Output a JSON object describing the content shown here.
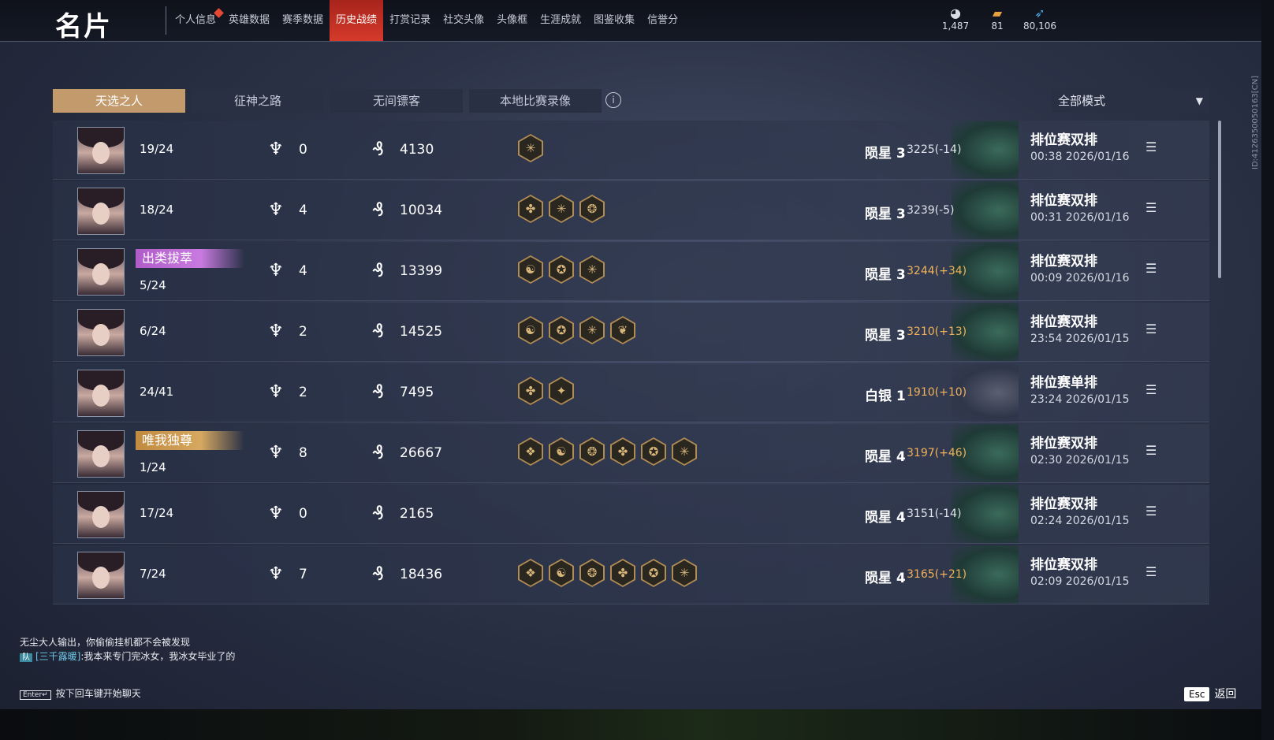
{
  "header": {
    "title": "名片",
    "nav": [
      {
        "label": "个人信息",
        "active": false,
        "dot": true
      },
      {
        "label": "英雄数据",
        "active": false
      },
      {
        "label": "赛季数据",
        "active": false
      },
      {
        "label": "历史战绩",
        "active": true
      },
      {
        "label": "打赏记录",
        "active": false
      },
      {
        "label": "社交头像",
        "active": false
      },
      {
        "label": "头像框",
        "active": false
      },
      {
        "label": "生涯成就",
        "active": false
      },
      {
        "label": "图鉴收集",
        "active": false
      },
      {
        "label": "信誉分",
        "active": false
      }
    ],
    "currencies": [
      {
        "icon": "mask-coin-icon",
        "value": "1,487"
      },
      {
        "icon": "ticket-icon",
        "value": "81"
      },
      {
        "icon": "feather-icon",
        "value": "80,106"
      }
    ]
  },
  "side_id": "ID:4126350050163[CN]",
  "tabs": [
    "天选之人",
    "征神之路",
    "无间镖客",
    "本地比赛录像"
  ],
  "active_tab": 0,
  "mode_select": {
    "value": "全部模式"
  },
  "matches": [
    {
      "rank": "19/24",
      "title": "",
      "kills": "0",
      "damage": "4130",
      "items": [
        "✳"
      ],
      "tier": "陨星 3",
      "score": "3225(-14)",
      "score_up": false,
      "emblem": "meteor",
      "type": "排位赛双排",
      "time": "00:38  2026/01/16"
    },
    {
      "rank": "18/24",
      "title": "",
      "kills": "4",
      "damage": "10034",
      "items": [
        "✤",
        "✳",
        "❂"
      ],
      "tier": "陨星 3",
      "score": "3239(-5)",
      "score_up": false,
      "emblem": "meteor",
      "type": "排位赛双排",
      "time": "00:31  2026/01/16"
    },
    {
      "rank": "5/24",
      "title": "出类拔萃",
      "title_color": "purple",
      "kills": "4",
      "damage": "13399",
      "items": [
        "☯",
        "✪",
        "✳"
      ],
      "tier": "陨星 3",
      "score": "3244(+34)",
      "score_up": true,
      "emblem": "meteor",
      "type": "排位赛双排",
      "time": "00:09  2026/01/16"
    },
    {
      "rank": "6/24",
      "title": "",
      "kills": "2",
      "damage": "14525",
      "items": [
        "☯",
        "✪",
        "✳",
        "❦"
      ],
      "tier": "陨星 3",
      "score": "3210(+13)",
      "score_up": true,
      "emblem": "meteor",
      "type": "排位赛双排",
      "time": "23:54  2026/01/15"
    },
    {
      "rank": "24/41",
      "title": "",
      "kills": "2",
      "damage": "7495",
      "items": [
        "✤",
        "✦"
      ],
      "tier": "白银 1",
      "score": "1910(+10)",
      "score_up": true,
      "emblem": "silver",
      "type": "排位赛单排",
      "time": "23:24  2026/01/15"
    },
    {
      "rank": "1/24",
      "title": "唯我独尊",
      "title_color": "gold",
      "kills": "8",
      "damage": "26667",
      "items": [
        "❖",
        "☯",
        "❂",
        "✤",
        "✪",
        "✳"
      ],
      "tier": "陨星 4",
      "score": "3197(+46)",
      "score_up": true,
      "emblem": "meteor",
      "type": "排位赛双排",
      "time": "02:30  2026/01/15"
    },
    {
      "rank": "17/24",
      "title": "",
      "kills": "0",
      "damage": "2165",
      "items": [],
      "tier": "陨星 4",
      "score": "3151(-14)",
      "score_up": false,
      "emblem": "meteor",
      "type": "排位赛双排",
      "time": "02:24  2026/01/15"
    },
    {
      "rank": "7/24",
      "title": "",
      "kills": "7",
      "damage": "18436",
      "items": [
        "❖",
        "☯",
        "❂",
        "✤",
        "✪",
        "✳"
      ],
      "tier": "陨星 4",
      "score": "3165(+21)",
      "score_up": true,
      "emblem": "meteor",
      "type": "排位赛双排",
      "time": "02:09  2026/01/15"
    }
  ],
  "chat": {
    "line1": "无尘大人输出，你偷偷挂机都不会被发现",
    "line2_tag": "队",
    "line2_name": "[三千露暖]",
    "line2_text": ":我本来专门完冰女，我冰女毕业了的",
    "hint_key": "Enter↵",
    "hint": "按下回车键开始聊天"
  },
  "esc": {
    "key": "Esc",
    "label": "返回"
  }
}
